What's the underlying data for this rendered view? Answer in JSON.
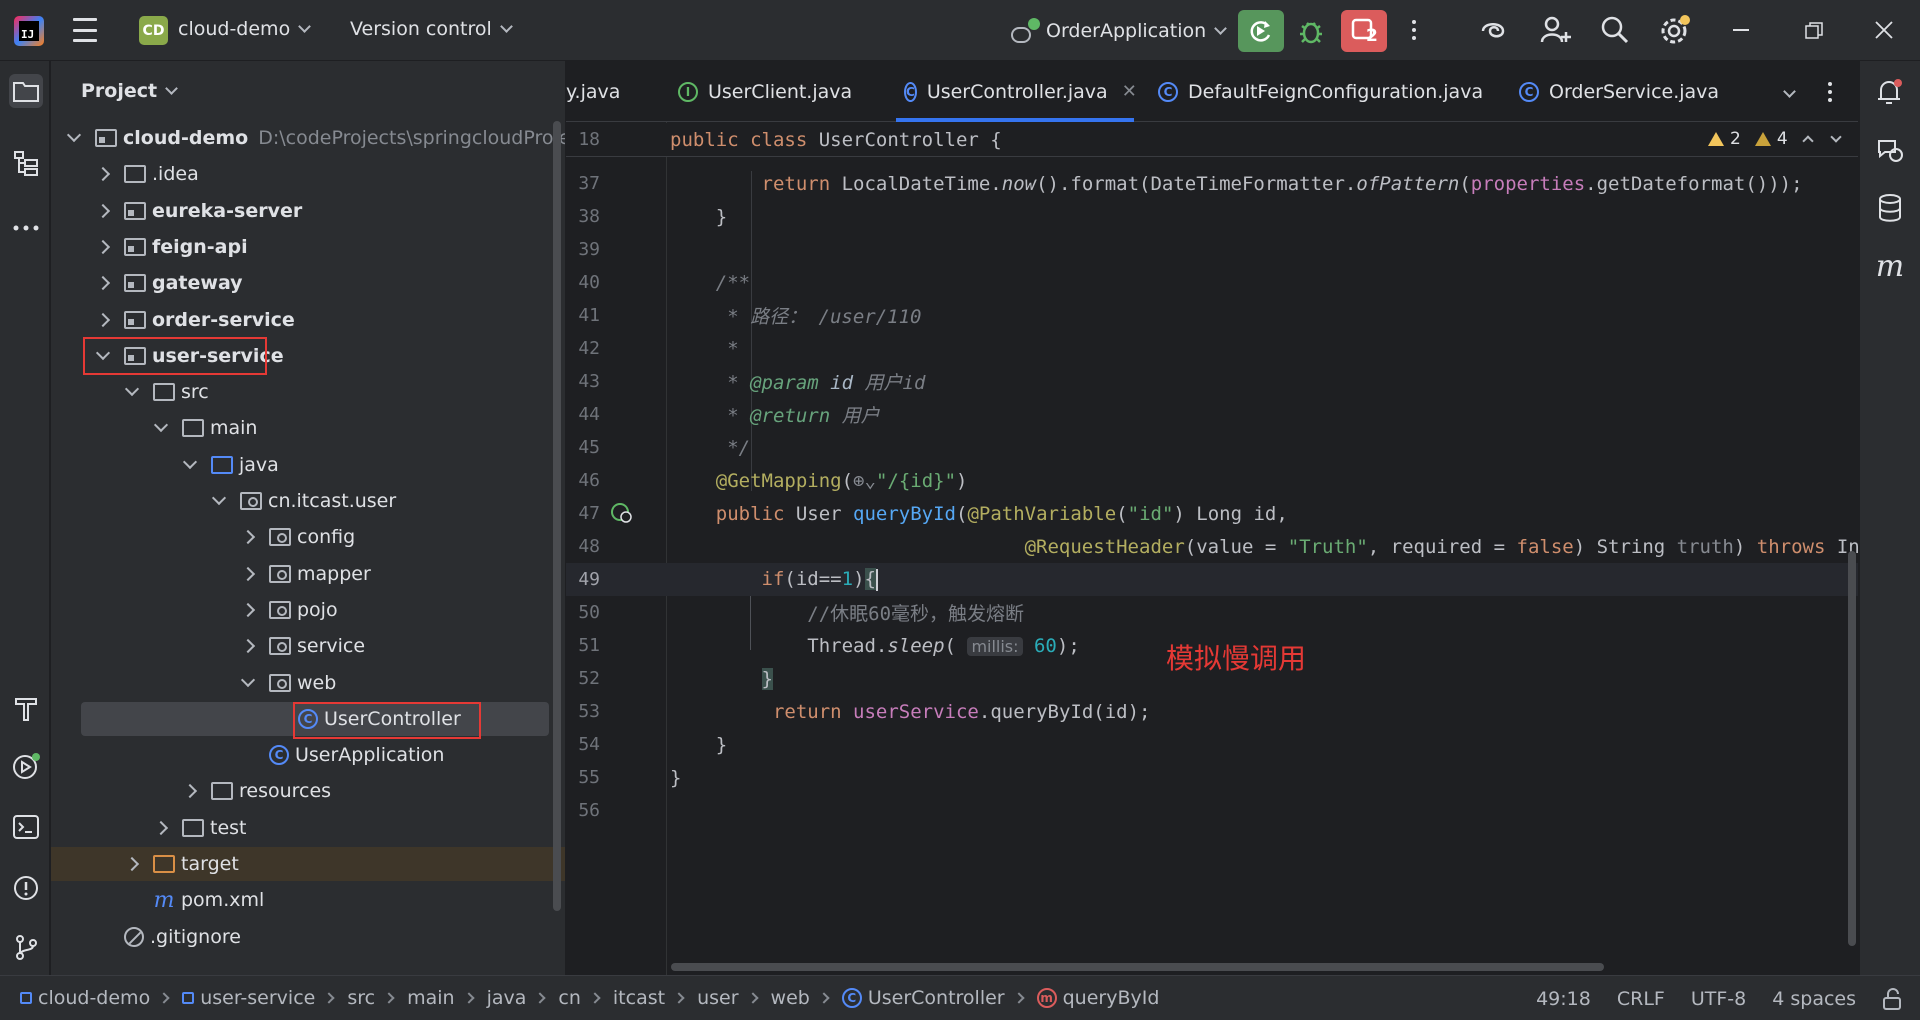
{
  "titlebar": {
    "app_logo": "IJ",
    "project_badge": "CD",
    "project_name": "cloud-demo",
    "vcs_label": "Version control",
    "run_config": "OrderApplication",
    "stop_badge": "2",
    "colors": {
      "run": "#57965c",
      "stop": "#db5c5c",
      "badge": "#8aa94a"
    }
  },
  "project_panel": {
    "title": "Project",
    "tree": [
      {
        "label": "cloud-demo",
        "hint": "D:\\codeProjects\\springcloudProject",
        "bold": true,
        "icon": "module-folder-icon",
        "state": "open",
        "depth": 0
      },
      {
        "label": ".idea",
        "icon": "folder-icon",
        "state": "closed",
        "depth": 1
      },
      {
        "label": "eureka-server",
        "bold": true,
        "icon": "module-folder-icon",
        "state": "closed",
        "depth": 1
      },
      {
        "label": "feign-api",
        "bold": true,
        "icon": "module-folder-icon",
        "state": "closed",
        "depth": 1
      },
      {
        "label": "gateway",
        "bold": true,
        "icon": "module-folder-icon",
        "state": "closed",
        "depth": 1
      },
      {
        "label": "order-service",
        "bold": true,
        "icon": "module-folder-icon",
        "state": "closed",
        "depth": 1
      },
      {
        "label": "user-service",
        "bold": true,
        "icon": "module-folder-icon",
        "state": "open",
        "depth": 1
      },
      {
        "label": "src",
        "icon": "folder-icon",
        "state": "open",
        "depth": 2
      },
      {
        "label": "main",
        "icon": "folder-icon",
        "state": "open",
        "depth": 3
      },
      {
        "label": "java",
        "icon": "source-folder-icon",
        "state": "open",
        "depth": 4
      },
      {
        "label": "cn.itcast.user",
        "icon": "package-icon",
        "state": "open",
        "depth": 5
      },
      {
        "label": "config",
        "icon": "package-icon",
        "state": "closed",
        "depth": 6
      },
      {
        "label": "mapper",
        "icon": "package-icon",
        "state": "closed",
        "depth": 6
      },
      {
        "label": "pojo",
        "icon": "package-icon",
        "state": "closed",
        "depth": 6
      },
      {
        "label": "service",
        "icon": "package-icon",
        "state": "closed",
        "depth": 6
      },
      {
        "label": "web",
        "icon": "package-icon",
        "state": "open",
        "depth": 6
      },
      {
        "label": "UserController",
        "icon": "class-icon",
        "state": "none",
        "depth": 7,
        "selected": true
      },
      {
        "label": "UserApplication",
        "icon": "spring-class-icon",
        "state": "none",
        "depth": 6
      },
      {
        "label": "resources",
        "icon": "resources-folder-icon",
        "state": "closed",
        "depth": 4
      },
      {
        "label": "test",
        "icon": "folder-icon",
        "state": "closed",
        "depth": 3
      },
      {
        "label": "target",
        "icon": "excluded-folder-icon",
        "state": "closed",
        "depth": 2,
        "excluded": true
      },
      {
        "label": "pom.xml",
        "icon": "maven-icon",
        "state": "none",
        "depth": 2
      },
      {
        "label": ".gitignore",
        "icon": "ignore-file-icon",
        "state": "none",
        "depth": 1
      }
    ]
  },
  "editor": {
    "tabs": [
      {
        "label": "y.java",
        "icon": "",
        "active": false
      },
      {
        "label": "UserClient.java",
        "icon": "interface-icon",
        "active": false
      },
      {
        "label": "UserController.java",
        "icon": "class-icon",
        "active": true
      },
      {
        "label": "DefaultFeignConfiguration.java",
        "icon": "class-icon",
        "active": false
      },
      {
        "label": "OrderService.java",
        "icon": "class-icon",
        "active": false
      }
    ],
    "sticky": {
      "line": "18",
      "text": "public class UserController {"
    },
    "inspections": {
      "warnings": "2",
      "weak_warnings": "4"
    },
    "annotation": "模拟慢调用"
  },
  "statusbar": {
    "breadcrumbs": [
      "cloud-demo",
      "user-service",
      "src",
      "main",
      "java",
      "cn",
      "itcast",
      "user",
      "web",
      "UserController",
      "queryById"
    ],
    "position": "49:18",
    "line_sep": "CRLF",
    "encoding": "UTF-8",
    "indent": "4 spaces"
  }
}
